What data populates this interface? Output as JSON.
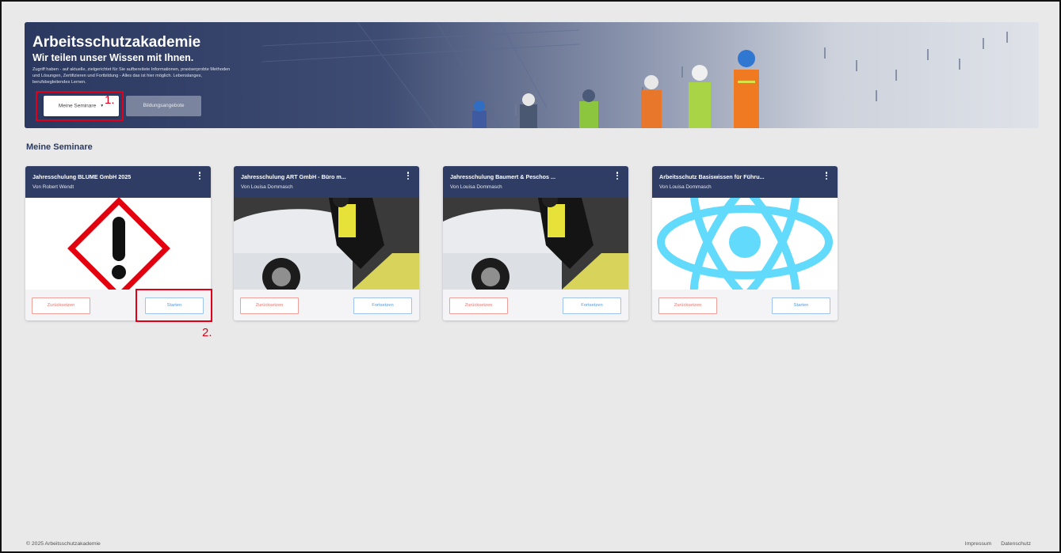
{
  "hero": {
    "title": "Arbeitsschutzakademie",
    "subtitle": "Wir teilen unser Wissen mit Ihnen.",
    "description": "Zugriff haben - auf aktuelle, zielgerichtet für Sie aufbereitete Informationen, praxiserprobte Methoden und Lösungen, Zertifizieren und Fortbildung - Alles das ist hier möglich. Lebenslanges, berufsbegleitendes Lernen.",
    "buttons": {
      "meine_seminare": "Meine Seminare",
      "bildungsangebote": "Bildungsangebote"
    }
  },
  "annotations": {
    "step1": "1.",
    "step2": "2.",
    "color": "#e0001a"
  },
  "section": {
    "title": "Meine Seminare"
  },
  "cards": [
    {
      "title": "Jahresschulung BLUME GmbH 2025",
      "author": "Von Robert Wendt",
      "image": "hazard-warning-icon",
      "reset_label": "Zurücksetzen",
      "action_label": "Starten"
    },
    {
      "title": "Jahresschulung ART GmbH - Büro m...",
      "author": "Von Louisa Dommasch",
      "image": "worker-car-photo",
      "reset_label": "Zurücksetzen",
      "action_label": "Fortsetzen"
    },
    {
      "title": "Jahresschulung Baumert & Peschos ...",
      "author": "Von Louisa Dommasch",
      "image": "worker-car-photo",
      "reset_label": "Zurücksetzen",
      "action_label": "Fortsetzen"
    },
    {
      "title": "Arbeitsschutz Basiswissen für Führu...",
      "author": "Von Louisa Dommasch",
      "image": "react-atom-icon",
      "reset_label": "Zurücksetzen",
      "action_label": "Starten"
    }
  ],
  "footer": {
    "copyright": "© 2025 Arbeitsschutzakademie",
    "links": [
      "Impressum",
      "Datenschutz"
    ]
  },
  "colors": {
    "header_navy": "#2f3c64",
    "reset_red": "#e57369",
    "action_blue": "#5a96d6",
    "background": "#e9e9ea"
  }
}
